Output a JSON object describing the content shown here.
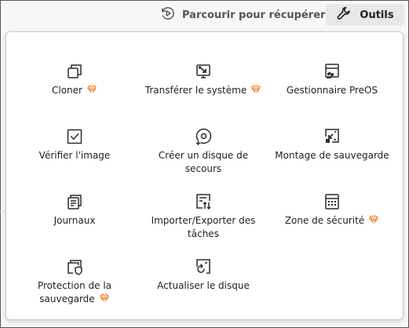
{
  "header": {
    "browse_label": "Parcourir pour récupérer",
    "tools_label": "Outils",
    "browse_icon": "clock-play-icon",
    "tools_icon": "wrench-icon"
  },
  "tools": [
    {
      "id": "clone",
      "label": "Cloner",
      "premium": true,
      "icon": "clone-icon"
    },
    {
      "id": "migrate",
      "label": "Transférer le système",
      "premium": true,
      "icon": "system-transfer-icon"
    },
    {
      "id": "preos",
      "label": "Gestionnaire PreOS",
      "premium": false,
      "icon": "preos-manager-icon"
    },
    {
      "id": "check",
      "label": "Vérifier l'image",
      "premium": false,
      "icon": "checkbox-icon"
    },
    {
      "id": "rescue",
      "label": "Créer un disque de secours",
      "premium": false,
      "icon": "disc-icon"
    },
    {
      "id": "mount",
      "label": "Montage de sauvegarde",
      "premium": false,
      "icon": "mount-icon"
    },
    {
      "id": "logs",
      "label": "Journaux",
      "premium": false,
      "icon": "logs-icon"
    },
    {
      "id": "tasks",
      "label": "Importer/Exporter des tâches",
      "premium": false,
      "icon": "import-export-icon"
    },
    {
      "id": "security",
      "label": "Zone de sécurité",
      "premium": true,
      "icon": "security-zone-icon"
    },
    {
      "id": "protect",
      "label": "Protection de la sauvegarde",
      "premium": true,
      "icon": "shield-document-icon"
    },
    {
      "id": "refresh",
      "label": "Actualiser le disque",
      "premium": false,
      "icon": "refresh-disk-icon"
    }
  ],
  "colors": {
    "premium": "#f28b30",
    "icon": "#2b2b2b",
    "text": "#1f1f1f"
  }
}
